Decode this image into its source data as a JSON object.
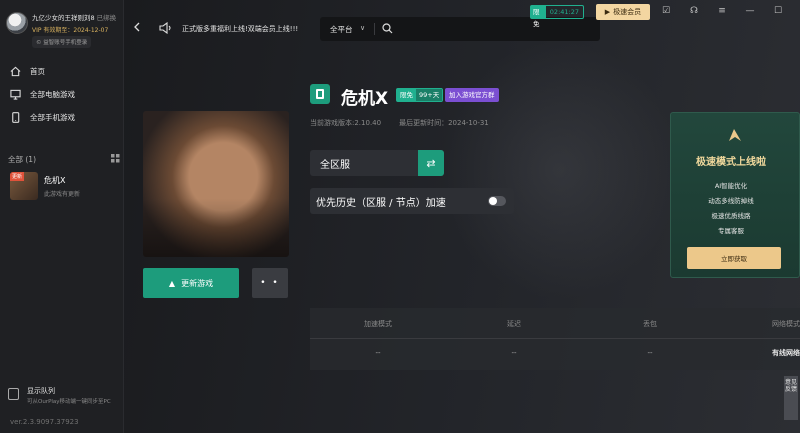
{
  "user": {
    "name": "九亿少女的王祥则刘8",
    "bind_tag": "已绑换",
    "vip_label": "VIP 有效期至：",
    "vip_date": "2024-12-07",
    "phone_login": "© 益智账号手机登录"
  },
  "nav": [
    {
      "label": "首页",
      "icon": "home-icon"
    },
    {
      "label": "全部电脑游戏",
      "icon": "monitor-icon"
    },
    {
      "label": "全部手机游戏",
      "icon": "phone-icon"
    }
  ],
  "game_list": {
    "header": "全部 (1)",
    "items": [
      {
        "name": "危机X",
        "status": "此游戏有更新",
        "badge": "更新"
      }
    ]
  },
  "queue": {
    "title": "显示队列",
    "subtitle": "可从OurPlay移动端一键同步至PC"
  },
  "version": "ver.2.3.9097.37923",
  "topbar": {
    "announcement": "正式版多重福利上线!双端会员上线!!!",
    "platform": "全平台",
    "timer_tag": "限免",
    "timer": "02:41:27",
    "vip_button": "极速会员"
  },
  "game": {
    "name": "危机X",
    "chip_free": "限免",
    "chip_days": "99+天",
    "chip_join": "加入游戏官方群",
    "version_line": "当前游戏版本:2.10.40",
    "update_time": "最后更新时间：2024-10-31",
    "region": "全区服",
    "priority_label": "优先历史（区服 / 节点）加速",
    "update_button": "更新游戏",
    "more_button": "• •"
  },
  "stats": {
    "headers": [
      "加速模式",
      "延迟",
      "丢包",
      "网络模式"
    ],
    "values": [
      "--",
      "--",
      "--",
      "有线网络"
    ]
  },
  "promo": {
    "title": "极速模式上线啦",
    "features": [
      "AI智能优化",
      "动态多线防掉线",
      "极速优质线路",
      "专属客服"
    ],
    "button": "立即获取"
  },
  "feedback": "意见反馈"
}
